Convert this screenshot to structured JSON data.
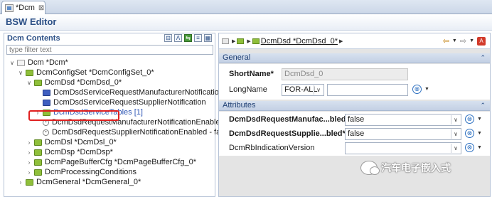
{
  "tab": {
    "label": "*Dcm",
    "close": "⊠"
  },
  "editor_title": "BSW Editor",
  "left": {
    "title": "Dcm Contents",
    "filter_placeholder": "type filter text",
    "tree": [
      {
        "label": "Dcm *Dcm*"
      },
      {
        "label": "DcmConfigSet *DcmConfigSet_0*"
      },
      {
        "label": "DcmDsd *DcmDsd_0*"
      },
      {
        "label": "DcmDsdServiceRequestManufacturerNotification"
      },
      {
        "label": "DcmDsdServiceRequestSupplierNotification"
      },
      {
        "label": "DcmDsdServiceTables [1]"
      },
      {
        "label": "DcmDsdRequestManufacturerNotificationEnabled -"
      },
      {
        "label": "DcmDsdRequestSupplierNotificationEnabled - false"
      },
      {
        "label": "DcmDsl *DcmDsl_0*"
      },
      {
        "label": "DcmDsp *DcmDsp*"
      },
      {
        "label": "DcmPageBufferCfg *DcmPageBufferCfg_0*"
      },
      {
        "label": "DcmProcessingConditions"
      },
      {
        "label": "DcmGeneral *DcmGeneral_0*"
      }
    ]
  },
  "right": {
    "breadcrumb": "DcmDsd *DcmDsd_0*",
    "general": {
      "heading": "General",
      "shortname_label": "ShortName*",
      "shortname_value": "DcmDsd_0",
      "longname_label": "LongName",
      "longname_lang": "FOR-ALL"
    },
    "attributes": {
      "heading": "Attributes",
      "rows": [
        {
          "label": "DcmDsdRequestManufac...bled*",
          "value": "false"
        },
        {
          "label": "DcmDsdRequestSupplie...bled*",
          "value": "false"
        },
        {
          "label": "DcmRbIndicationVersion",
          "value": ""
        }
      ]
    }
  },
  "watermark": "汽车电子嵌入式",
  "colors": {
    "accent": "#2b4f86",
    "folder": "#8fbf3a",
    "highlight": "#e02020"
  }
}
